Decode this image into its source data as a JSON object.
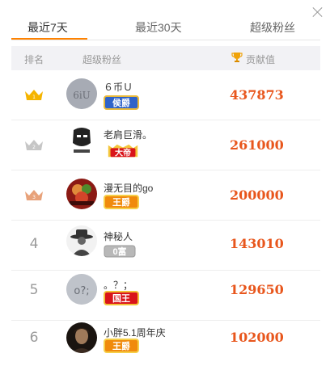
{
  "tabs": [
    {
      "label": "最近7天"
    },
    {
      "label": "最近30天"
    },
    {
      "label": "超级粉丝"
    }
  ],
  "colors": {
    "accent": "#ff8200",
    "value": "#e8561c"
  },
  "table": {
    "headers": {
      "rank": "排名",
      "fan": "超级粉丝",
      "contribution": "贡献值"
    },
    "rows": [
      {
        "rank": "1",
        "crown": "gold-crown-icon",
        "name": "６币Ｕ",
        "badge": "侯爵",
        "value": "437873"
      },
      {
        "rank": "2",
        "crown": "silver-crown-icon",
        "name": "老肩巨滑。",
        "badge": "大帝",
        "value": "261000"
      },
      {
        "rank": "3",
        "crown": "bronze-crown-icon",
        "name": "漫无目的go",
        "badge": "王爵",
        "value": "200000"
      },
      {
        "rank": "4",
        "name": "神秘人",
        "badge": "0富",
        "value": "143010"
      },
      {
        "rank": "5",
        "name": "。？；",
        "badge": "国王",
        "value": "129650"
      },
      {
        "rank": "6",
        "name": "小胖5.1周年庆",
        "badge": "王爵",
        "value": "102000"
      }
    ]
  }
}
